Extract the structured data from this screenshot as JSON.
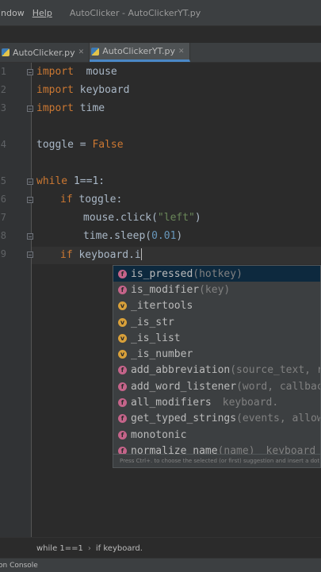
{
  "titlebar": {
    "menus": [
      "indow",
      "Help"
    ],
    "window_title": "AutoClicker - AutoClickerYT.py"
  },
  "tabs": [
    {
      "label": "AutoClicker.py",
      "active": false
    },
    {
      "label": "AutoClickerYT.py",
      "active": true
    }
  ],
  "gutter": {
    "line_numbers": [
      "1",
      "2",
      "3",
      "4",
      "5",
      "6",
      "7",
      "8",
      "9",
      "0",
      "1"
    ]
  },
  "code": {
    "l1": {
      "kw": "import",
      "rest": "  mouse"
    },
    "l2": {
      "kw": "import",
      "rest": " keyboard"
    },
    "l3": {
      "kw": "import",
      "rest": " time"
    },
    "l5": {
      "pre": "toggle = ",
      "kw": "False"
    },
    "l7": {
      "kw": "while",
      "rest": " 1==1:"
    },
    "l8": {
      "kw": "if",
      "rest": " toggle:"
    },
    "l9": {
      "pre": "mouse.click(",
      "str": "\"left\"",
      "post": ")"
    },
    "l10": {
      "pre": "time.sleep(",
      "num": "0.01",
      "post": ")"
    },
    "l11": {
      "kw": "if",
      "rest": " keyboard.i"
    }
  },
  "completion": {
    "items": [
      {
        "kind": "f",
        "name": "is_pressed",
        "hint": "(hotkey)",
        "source": ""
      },
      {
        "kind": "f",
        "name": "is_modifier",
        "hint": "(key)",
        "source": ""
      },
      {
        "kind": "v",
        "name": "_itertools",
        "hint": "",
        "source": ""
      },
      {
        "kind": "v",
        "name": "_is_str",
        "hint": "",
        "source": ""
      },
      {
        "kind": "v",
        "name": "_is_list",
        "hint": "",
        "source": ""
      },
      {
        "kind": "v",
        "name": "_is_number",
        "hint": "",
        "source": ""
      },
      {
        "kind": "f",
        "name": "add_abbreviation",
        "hint": "(source_text, re",
        "source": ""
      },
      {
        "kind": "f",
        "name": "add_word_listener",
        "hint": "(word, callback",
        "source": ""
      },
      {
        "kind": "f",
        "name": "all_modifiers",
        "hint": "",
        "source": "keyboard."
      },
      {
        "kind": "f",
        "name": "get_typed_strings",
        "hint": "(events, allow_",
        "source": ""
      },
      {
        "kind": "f",
        "name": "monotonic",
        "hint": "",
        "source": ""
      },
      {
        "kind": "f",
        "name": "normalize_name",
        "hint": "(name)",
        "source": "keyboard"
      }
    ],
    "footer": "Press Ctrl+. to choose the selected (or first) suggestion and insert a dot afterwards"
  },
  "breadcrumb": [
    "while 1==1",
    "if keyboard."
  ],
  "statusbar": {
    "tool": "on Console"
  },
  "colors": {
    "editor_bg": "#2b2b2b",
    "keyword": "#cc7832",
    "string": "#6a8759",
    "number": "#6897bb",
    "selection": "#0d293e"
  }
}
